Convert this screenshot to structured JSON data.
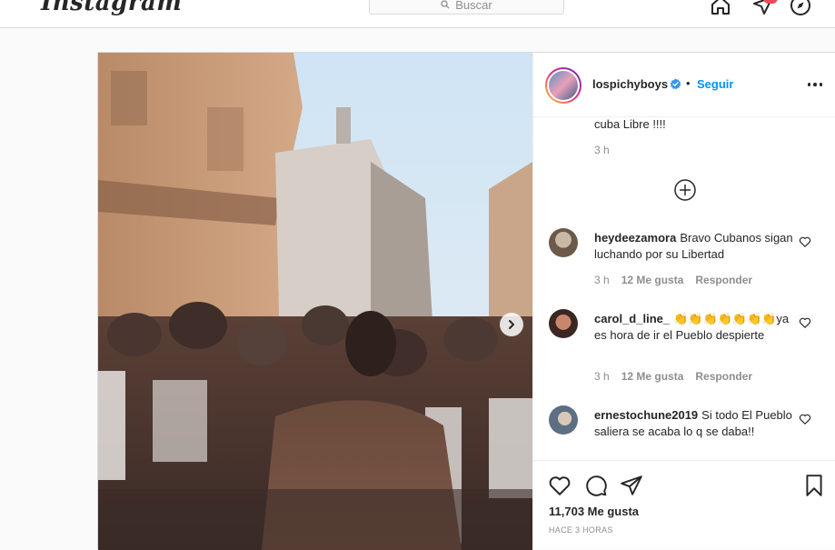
{
  "header": {
    "logo": "Instagram",
    "search_placeholder": "Buscar"
  },
  "post": {
    "author": {
      "username": "lospichyboys",
      "separator": "•",
      "follow_label": "Seguir"
    },
    "previous_comment": {
      "text": "cuba Libre !!!!",
      "time": "3 h"
    },
    "comments": [
      {
        "username": "heydeezamora",
        "text": "Bravo Cubanos sigan luchando por su Libertad",
        "time": "3 h",
        "likes": "12 Me gusta",
        "reply": "Responder"
      },
      {
        "username": "carol_d_line_",
        "text": "👏👏👏👏👏👏👏ya es hora de ir el Pueblo despierte",
        "time": "3 h",
        "likes": "12 Me gusta",
        "reply": "Responder"
      },
      {
        "username": "ernestochune2019",
        "text": "Si todo El Pueblo saliera se acaba lo q se daba!!",
        "time": "",
        "likes": "",
        "reply": ""
      }
    ],
    "likes_count": "11,703 Me gusta",
    "posted_time": "HACE 3 HORAS"
  },
  "icons": {
    "home": "home-icon",
    "direct": "direct-icon",
    "explore": "explore-icon",
    "next": "chevron-right-icon",
    "like": "heart-icon",
    "comment": "comment-icon",
    "share": "share-icon",
    "save": "bookmark-icon",
    "verified": "verified-badge-icon",
    "load_more": "plus-circle-icon"
  },
  "colors": {
    "link_blue": "#0095f6",
    "notification_red": "#ed4956",
    "border": "#dbdbdb",
    "muted_text": "#8e8e8e"
  }
}
